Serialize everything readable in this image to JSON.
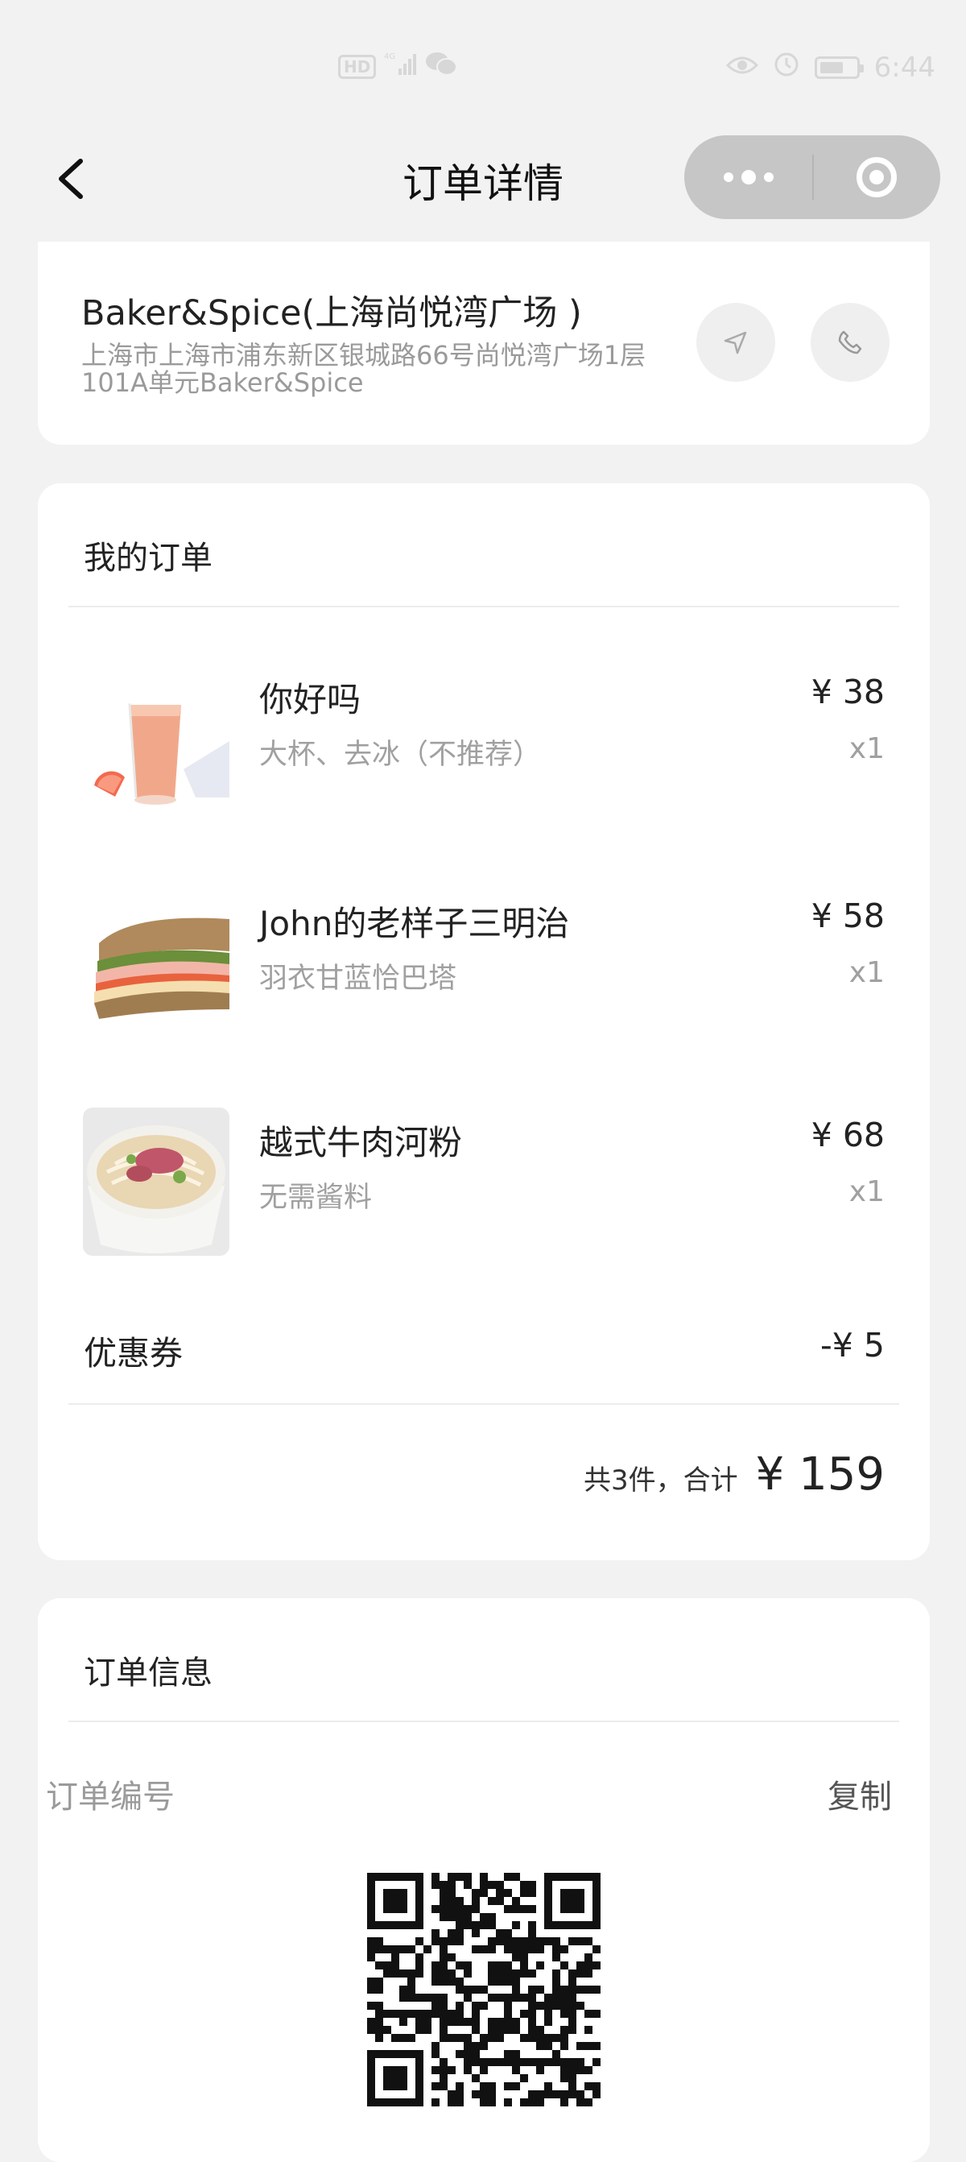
{
  "status_bar": {
    "hd_label": "HD",
    "network": "4G",
    "time": "6:44"
  },
  "nav": {
    "title": "订单详情"
  },
  "store": {
    "name": "Baker&Spice(上海尚悦湾广场 )",
    "address": "上海市上海市浦东新区银城路66号尚悦湾广场1层101A单元Baker&Spice"
  },
  "order": {
    "section_title": "我的订单",
    "items": [
      {
        "name": "你好吗",
        "spec": "大杯、去冰（不推荐）",
        "price": "¥ 38",
        "qty": "x1"
      },
      {
        "name": "John的老样子三明治",
        "spec": "羽衣甘蓝恰巴塔",
        "price": "¥ 58",
        "qty": "x1"
      },
      {
        "name": "越式牛肉河粉",
        "spec": "无需酱料",
        "price": "¥ 68",
        "qty": "x1"
      }
    ],
    "coupon_label": "优惠券",
    "coupon_value": "-¥ 5",
    "total_count": "共3件，合计",
    "total_amount": "¥ 159"
  },
  "info": {
    "section_title": "订单信息",
    "order_no_label": "订单编号",
    "copy_label": "复制"
  },
  "icons": {
    "back": "chevron-left-icon",
    "more": "more-dots-icon",
    "close": "target-icon",
    "navigate": "navigation-arrow-icon",
    "phone": "phone-icon",
    "qr": "qr-code-icon"
  },
  "colors": {
    "background": "#f2f2f2",
    "card": "#ffffff",
    "capsule": "#c6c6c6",
    "muted_text": "#9a9a9a"
  }
}
